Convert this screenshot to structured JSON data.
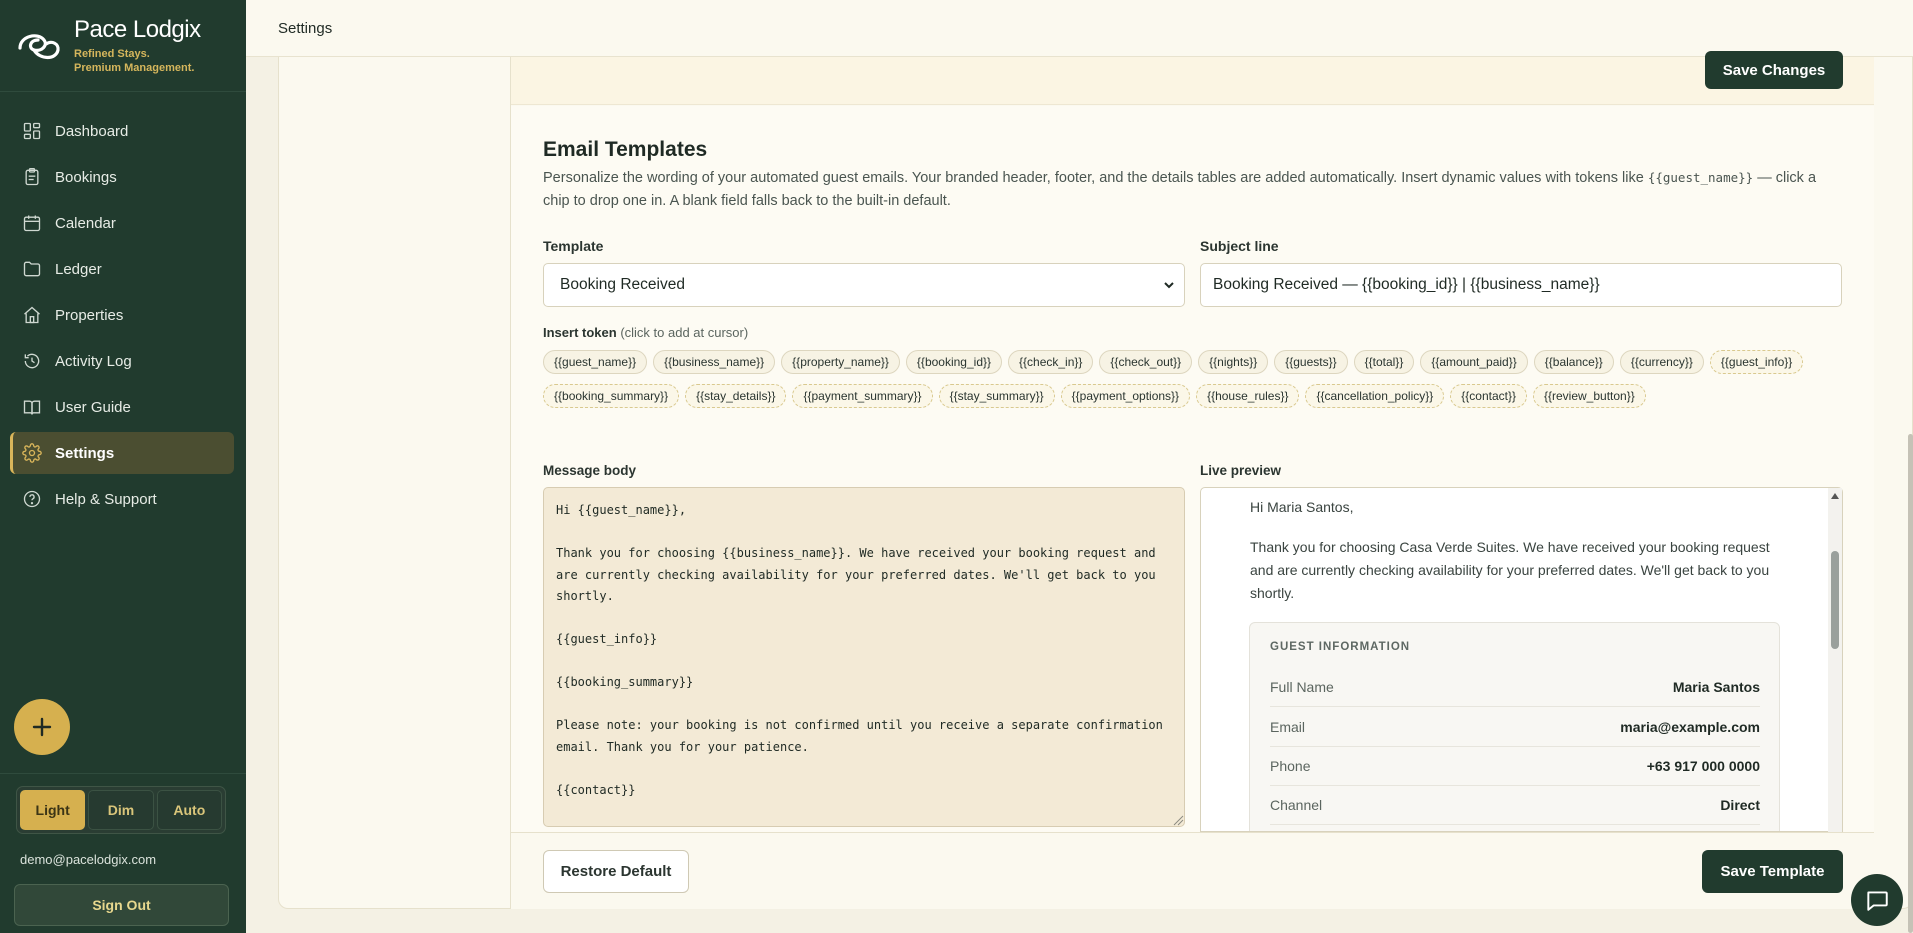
{
  "brand": {
    "name": "Pace Lodgix",
    "tagline_1": "Refined Stays.",
    "tagline_2": "Premium Management."
  },
  "sidebar": {
    "items": [
      {
        "label": "Dashboard",
        "icon": "dashboard-icon"
      },
      {
        "label": "Bookings",
        "icon": "clipboard-icon"
      },
      {
        "label": "Calendar",
        "icon": "calendar-icon"
      },
      {
        "label": "Ledger",
        "icon": "folder-icon"
      },
      {
        "label": "Properties",
        "icon": "home-icon"
      },
      {
        "label": "Activity Log",
        "icon": "history-icon"
      },
      {
        "label": "User Guide",
        "icon": "book-icon"
      },
      {
        "label": "Settings",
        "icon": "gear-icon",
        "active": true
      },
      {
        "label": "Help & Support",
        "icon": "help-icon"
      }
    ],
    "theme": {
      "light": "Light",
      "dim": "Dim",
      "auto": "Auto",
      "selected": "Light"
    },
    "email": "demo@pacelodgix.com",
    "sign_out": "Sign Out"
  },
  "topbar": {
    "title": "Settings"
  },
  "settings": {
    "save_changes": "Save Changes"
  },
  "email_templates": {
    "title": "Email Templates",
    "description_1": "Personalize the wording of your automated guest emails. Your branded header, footer, and the details tables are added automatically. Insert dynamic values with tokens like ",
    "description_token": "{{guest_name}}",
    "description_2": " — click a chip to drop one in. A blank field falls back to the built-in default.",
    "template_label": "Template",
    "template_value": "Booking Received",
    "subject_label": "Subject line",
    "subject_value": "Booking Received — {{booking_id}} | {{business_name}}",
    "insert_token_label": "Insert token",
    "insert_token_hint": "(click to add at cursor)",
    "tokens": [
      {
        "label": "{{guest_name}}",
        "kind": "value"
      },
      {
        "label": "{{business_name}}",
        "kind": "value"
      },
      {
        "label": "{{property_name}}",
        "kind": "value"
      },
      {
        "label": "{{booking_id}}",
        "kind": "value"
      },
      {
        "label": "{{check_in}}",
        "kind": "value"
      },
      {
        "label": "{{check_out}}",
        "kind": "value"
      },
      {
        "label": "{{nights}}",
        "kind": "value"
      },
      {
        "label": "{{guests}}",
        "kind": "value"
      },
      {
        "label": "{{total}}",
        "kind": "value"
      },
      {
        "label": "{{amount_paid}}",
        "kind": "value"
      },
      {
        "label": "{{balance}}",
        "kind": "value"
      },
      {
        "label": "{{currency}}",
        "kind": "value"
      },
      {
        "label": "{{guest_info}}",
        "kind": "block"
      },
      {
        "label": "{{booking_summary}}",
        "kind": "block"
      },
      {
        "label": "{{stay_details}}",
        "kind": "block"
      },
      {
        "label": "{{payment_summary}}",
        "kind": "block"
      },
      {
        "label": "{{stay_summary}}",
        "kind": "block"
      },
      {
        "label": "{{payment_options}}",
        "kind": "block"
      },
      {
        "label": "{{house_rules}}",
        "kind": "block"
      },
      {
        "label": "{{cancellation_policy}}",
        "kind": "block"
      },
      {
        "label": "{{contact}}",
        "kind": "block"
      },
      {
        "label": "{{review_button}}",
        "kind": "block"
      }
    ],
    "message_label": "Message body",
    "message_body": "Hi {{guest_name}},\n\nThank you for choosing {{business_name}}. We have received your booking request and\nare currently checking availability for your preferred dates. We'll get back to you\nshortly.\n\n{{guest_info}}\n\n{{booking_summary}}\n\nPlease note: your booking is not confirmed until you receive a separate confirmation\nemail. Thank you for your patience.\n\n{{contact}}",
    "preview_label": "Live preview",
    "preview": {
      "greeting": "Hi Maria Santos,",
      "paragraph": "Thank you for choosing Casa Verde Suites. We have received your booking request and are currently checking availability for your preferred dates. We'll get back to you shortly.",
      "guest_info_title": "GUEST INFORMATION",
      "rows": [
        {
          "key": "Full Name",
          "value": "Maria Santos"
        },
        {
          "key": "Email",
          "value": "maria@example.com"
        },
        {
          "key": "Phone",
          "value": "+63 917 000 0000"
        },
        {
          "key": "Channel",
          "value": "Direct"
        }
      ]
    },
    "restore_default": "Restore Default",
    "save_template": "Save Template"
  },
  "colors": {
    "sidebar_bg": "#213b2e",
    "accent_gold": "#d6b04f",
    "page_bg": "#f4f1e4"
  }
}
